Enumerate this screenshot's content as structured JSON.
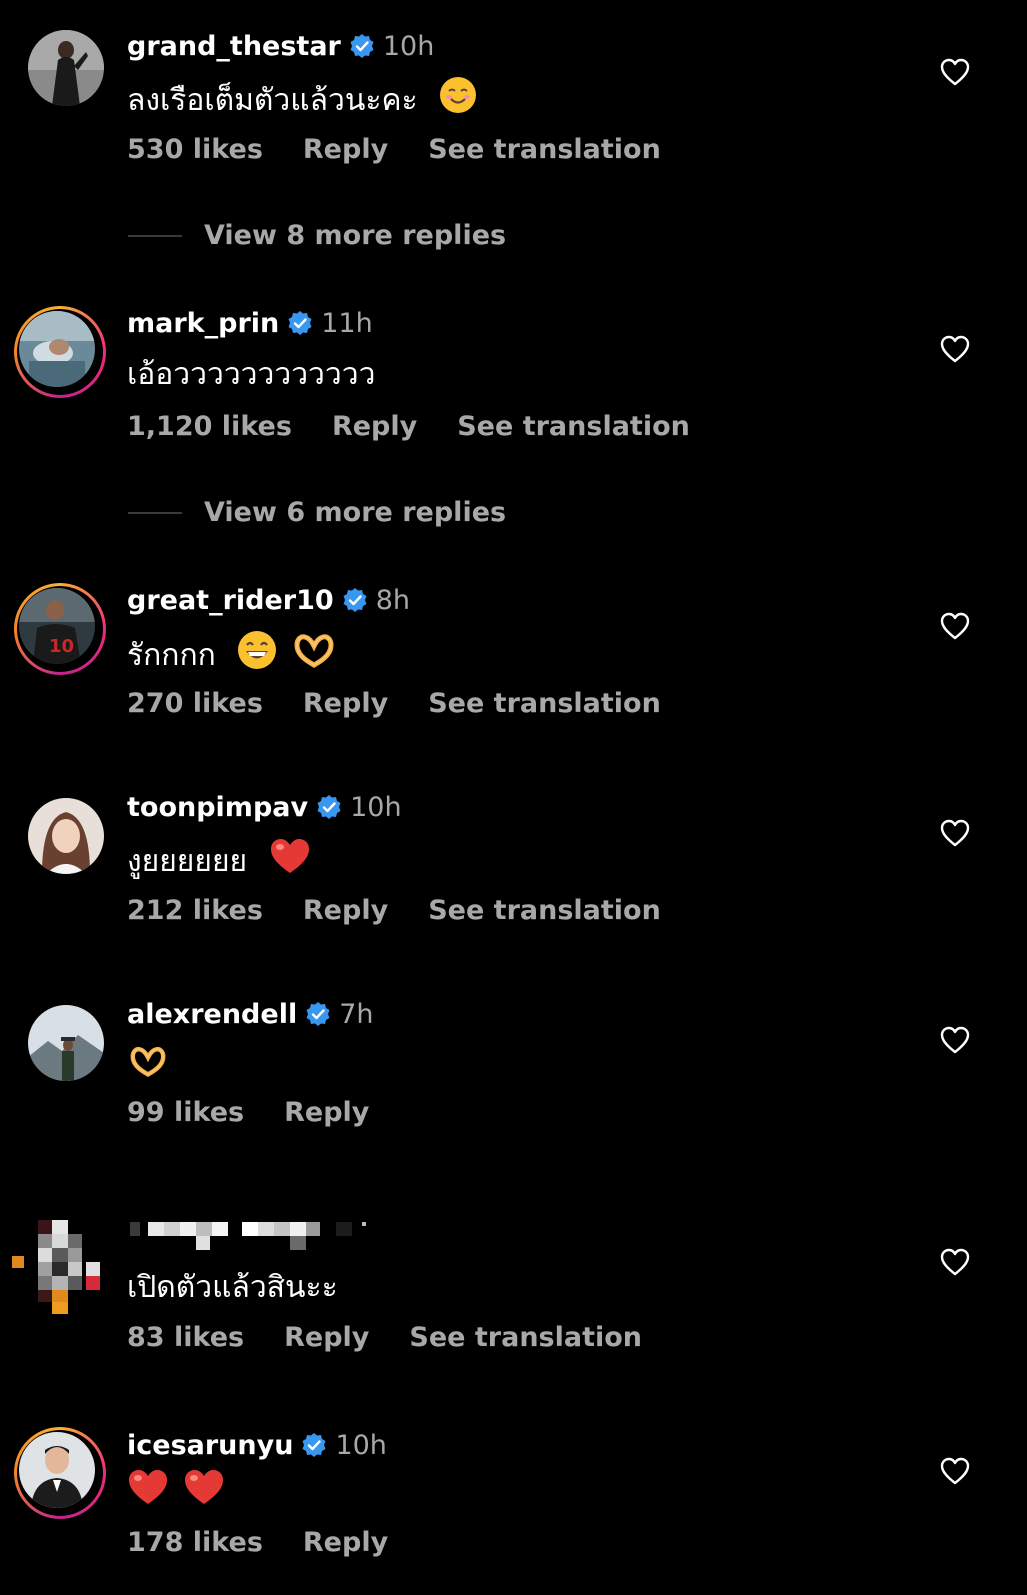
{
  "colors": {
    "background": "#000000",
    "text": "#ffffff",
    "muted": "#a8a8a8",
    "verified": "#3897f0",
    "story_ring": "#ee2a7b"
  },
  "labels": {
    "reply": "Reply",
    "see_translation": "See translation"
  },
  "comments": [
    {
      "username": "grand_thestar",
      "verified": true,
      "time": "10h",
      "text": "ลงเรือเต็มตัวแล้วนะคะ",
      "emoji": "☺️",
      "likes": "530 likes",
      "reply": "Reply",
      "see_translation": "See translation",
      "more_replies": "View 8 more replies"
    },
    {
      "username": "mark_prin",
      "verified": true,
      "time": "11h",
      "text": "เอ้อวววววววววววว",
      "likes": "1,120 likes",
      "reply": "Reply",
      "see_translation": "See translation",
      "more_replies": "View 6 more replies"
    },
    {
      "username": "great_rider10",
      "verified": true,
      "time": "8h",
      "text": "รักกกก",
      "emoji": "😁🫶",
      "likes": "270 likes",
      "reply": "Reply",
      "see_translation": "See translation"
    },
    {
      "username": "toonpimpav",
      "verified": true,
      "time": "10h",
      "text": "งูยยยยยย",
      "emoji": "❤️",
      "likes": "212 likes",
      "reply": "Reply",
      "see_translation": "See translation"
    },
    {
      "username": "alexrendell",
      "verified": true,
      "time": "7h",
      "text": "",
      "emoji": "🫶",
      "likes": "99 likes",
      "reply": "Reply"
    },
    {
      "username": "",
      "verified": false,
      "time": "",
      "text": "เปิดตัวแล้วสินะะ",
      "likes": "83 likes",
      "reply": "Reply",
      "see_translation": "See translation"
    },
    {
      "username": "icesarunyu",
      "verified": true,
      "time": "10h",
      "text": "",
      "emoji": "❤️❤️",
      "likes": "178 likes",
      "reply": "Reply"
    }
  ]
}
